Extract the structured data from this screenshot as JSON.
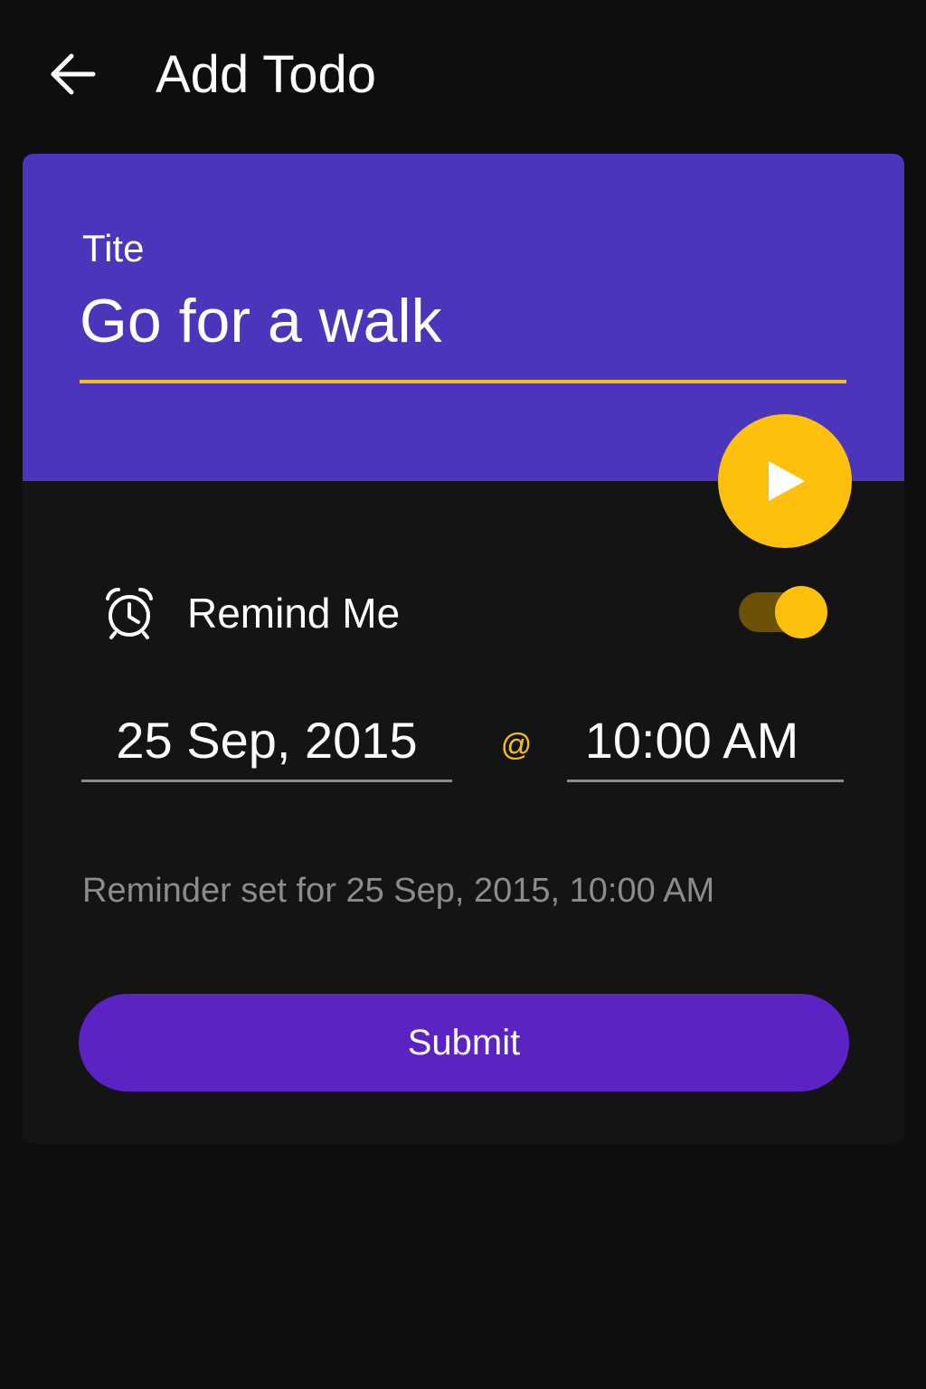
{
  "app_bar": {
    "back_icon": "arrow-left-icon",
    "title": "Add Todo"
  },
  "title_field": {
    "label": "Tite",
    "value": "Go for a walk"
  },
  "fab": {
    "icon": "play-icon"
  },
  "reminder": {
    "icon": "alarm-clock-icon",
    "label": "Remind Me",
    "toggle_on": true,
    "date": "25 Sep, 2015",
    "separator": "@",
    "time": "10:00 AM",
    "summary": "Reminder set for 25 Sep, 2015, 10:00 AM"
  },
  "submit": {
    "label": "Submit"
  },
  "colors": {
    "background": "#0e0e0e",
    "card": "#141414",
    "header": "#4a35bb",
    "accent_yellow": "#fdc10d",
    "submit_purple": "#5b22c4",
    "muted_text": "#8c8c8c"
  }
}
